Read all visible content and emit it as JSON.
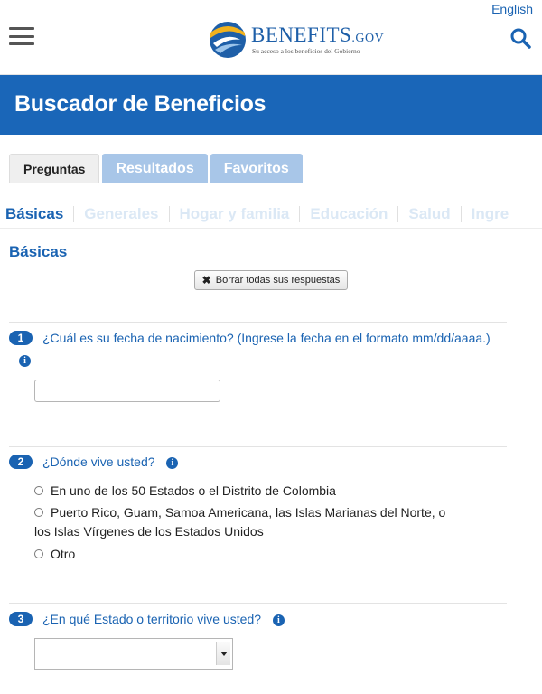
{
  "header": {
    "language_link": "English",
    "logo": {
      "wordmark": "BENEFITS",
      "wordmark_suffix": ".GOV",
      "tagline": "Su acceso a los beneficios del Gobierno"
    },
    "menu_icon": "hamburger-menu-icon",
    "search_icon": "search-icon"
  },
  "banner": {
    "title": "Buscador de Beneficios"
  },
  "tabs": [
    {
      "label": "Preguntas",
      "active": true
    },
    {
      "label": "Resultados",
      "active": false
    },
    {
      "label": "Favoritos",
      "active": false
    }
  ],
  "subnav": [
    {
      "label": "Básicas",
      "current": true
    },
    {
      "label": "Generales",
      "current": false
    },
    {
      "label": "Hogar y familia",
      "current": false
    },
    {
      "label": "Educación",
      "current": false
    },
    {
      "label": "Salud",
      "current": false
    },
    {
      "label": "Ingre",
      "current": false
    }
  ],
  "section_title": "Básicas",
  "clear_button": {
    "label": "Borrar todas sus respuestas",
    "icon": "close-icon"
  },
  "questions": [
    {
      "number": "1",
      "text": "¿Cuál es su fecha de nacimiento? (Ingrese la fecha en el formato mm/dd/aaaa.)",
      "input_value": ""
    },
    {
      "number": "2",
      "text": "¿Dónde vive usted?",
      "options": [
        "En uno de los 50 Estados o el Distrito de Colombia",
        "Puerto Rico, Guam, Samoa Americana, las Islas Marianas del Norte, o",
        "los Islas Vírgenes de los Estados Unidos",
        "Otro"
      ]
    },
    {
      "number": "3",
      "text": "¿En qué Estado o territorio vive usted?",
      "selected_value": ""
    }
  ],
  "colors": {
    "brand_blue": "#1a66b8",
    "link_blue": "#1a63b2",
    "inactive_tab": "#a8c6e8",
    "inactive_subnav": "#dbe8f5"
  }
}
